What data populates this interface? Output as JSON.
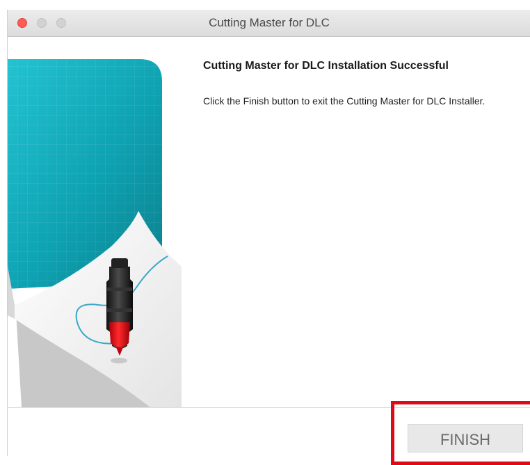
{
  "window": {
    "title": "Cutting Master for DLC"
  },
  "installer": {
    "heading": "Cutting Master for DLC Installation Successful",
    "message": "Click the Finish button to exit the Cutting Master for DLC Installer."
  },
  "footer": {
    "finish_label": "FINISH"
  },
  "colors": {
    "accent_teal": "#11a3b3",
    "highlight_red": "#e00a17"
  }
}
